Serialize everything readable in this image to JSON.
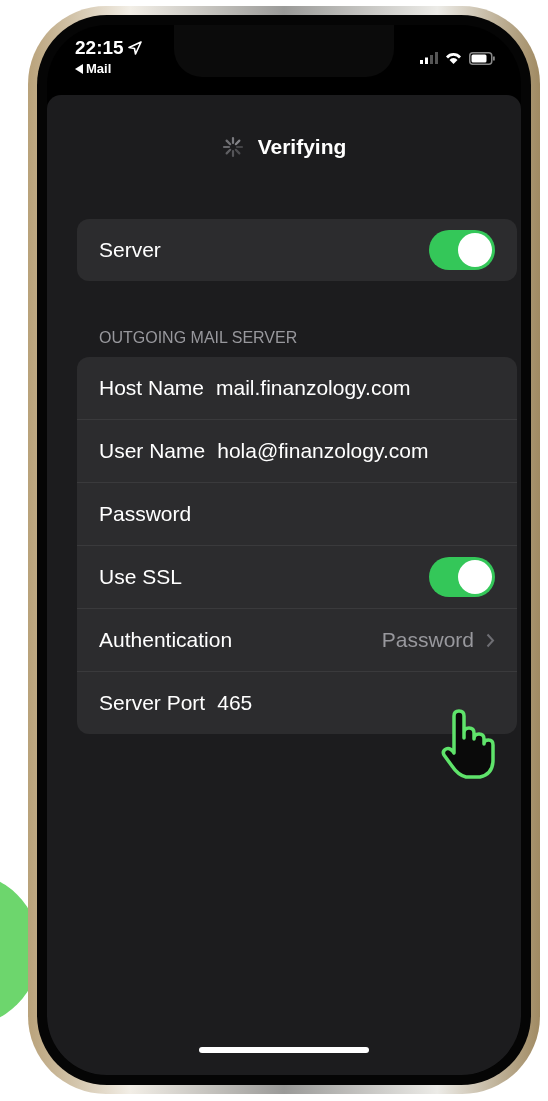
{
  "status_bar": {
    "time": "22:15",
    "back_label": "Mail"
  },
  "header": {
    "title": "Verifying"
  },
  "account": {
    "label": "Server",
    "on": true
  },
  "outgoing": {
    "header": "OUTGOING MAIL SERVER",
    "rows": [
      {
        "kind": "field",
        "label": "Host Name",
        "value": "mail.finanzology.com"
      },
      {
        "kind": "field",
        "label": "User Name",
        "value": "hola@finanzology.com"
      },
      {
        "kind": "field",
        "label": "Password"
      },
      {
        "kind": "toggle",
        "label": "Use SSL",
        "on": true
      },
      {
        "kind": "link",
        "label": "Authentication",
        "value": "Password"
      },
      {
        "kind": "field",
        "label": "Server Port",
        "value": "465"
      }
    ]
  }
}
